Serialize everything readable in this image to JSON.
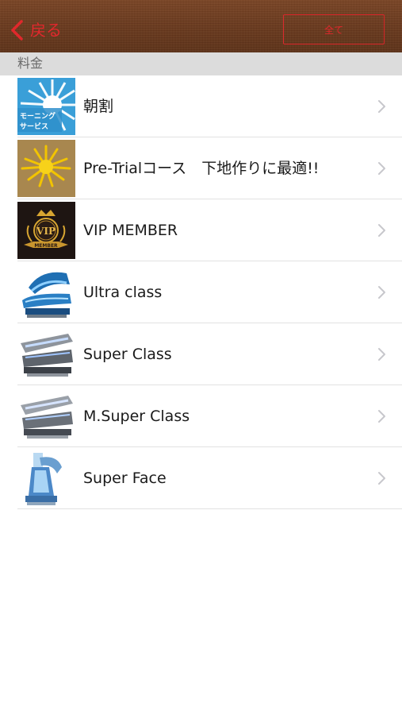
{
  "header": {
    "back_label": "戻る",
    "all_label": "全て"
  },
  "section": {
    "title": "料金"
  },
  "items": [
    {
      "label": "朝割",
      "thumb_text": [
        "モーニング",
        "サービス"
      ],
      "icon": "morning-service-icon"
    },
    {
      "label": "Pre-Trialコース　下地作りに最適!!",
      "icon": "sun-burst-icon"
    },
    {
      "label": "VIP MEMBER",
      "thumb_text": [
        "VIP",
        "MEMBER"
      ],
      "icon": "vip-badge-icon"
    },
    {
      "label": "Ultra class",
      "icon": "tanning-bed-icon"
    },
    {
      "label": "Super Class",
      "icon": "tanning-bed-icon"
    },
    {
      "label": "M.Super Class",
      "icon": "tanning-bed-icon"
    },
    {
      "label": "Super Face",
      "icon": "face-tanner-icon"
    }
  ],
  "colors": {
    "header_bg": "#6b3a1f",
    "accent_red": "#e0282c",
    "section_bg": "#dcdcdc"
  }
}
